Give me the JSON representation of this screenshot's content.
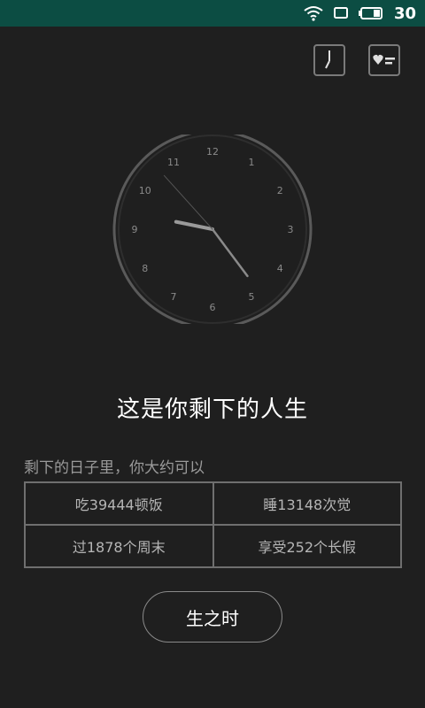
{
  "status_bar": {
    "battery": "30",
    "icons": [
      "wifi-icon",
      "screen-icon",
      "battery-icon"
    ]
  },
  "top_actions": [
    {
      "icon": "clock-hand-icon"
    },
    {
      "icon": "heart-list-icon"
    }
  ],
  "clock": {
    "numbers": [
      "12",
      "1",
      "2",
      "3",
      "4",
      "5",
      "6",
      "7",
      "8",
      "9",
      "10",
      "11"
    ],
    "time": {
      "hour": 9,
      "minute": 23,
      "second": 53
    }
  },
  "main": {
    "title": "这是你剩下的人生",
    "subtitle": "剩下的日子里，你大约可以",
    "stats": [
      {
        "text": "吃39444顿饭"
      },
      {
        "text": "睡13148次觉"
      },
      {
        "text": "过1878个周末"
      },
      {
        "text": "享受252个长假"
      }
    ],
    "button_label": "生之时"
  },
  "colors": {
    "background": "#1f1f1f",
    "status_bar": "#0c4d43",
    "text_primary": "#ffffff",
    "text_secondary": "#9a9a9a"
  }
}
